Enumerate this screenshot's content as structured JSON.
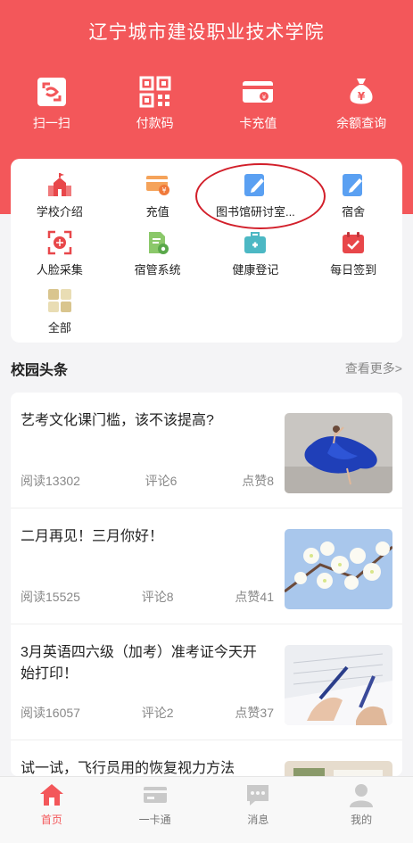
{
  "header": {
    "title": "辽宁城市建设职业技术学院",
    "quick_actions": [
      {
        "label": "扫一扫",
        "icon": "scan-icon"
      },
      {
        "label": "付款码",
        "icon": "qr-code-icon"
      },
      {
        "label": "卡充值",
        "icon": "card-recharge-icon"
      },
      {
        "label": "余额查询",
        "icon": "money-bag-icon"
      }
    ]
  },
  "services": [
    {
      "label": "学校介绍",
      "icon": "school-building-icon"
    },
    {
      "label": "充值",
      "icon": "recharge-card-icon"
    },
    {
      "label": "图书馆研讨室...",
      "icon": "edit-note-icon"
    },
    {
      "label": "宿舍",
      "icon": "edit-note-icon"
    },
    {
      "label": "人脸采集",
      "icon": "face-scan-icon"
    },
    {
      "label": "宿管系统",
      "icon": "document-gear-icon"
    },
    {
      "label": "健康登记",
      "icon": "health-kit-icon"
    },
    {
      "label": "每日签到",
      "icon": "calendar-check-icon"
    },
    {
      "label": "全部",
      "icon": "grid-all-icon"
    }
  ],
  "news_section": {
    "title": "校园头条",
    "more": "查看更多>"
  },
  "news": [
    {
      "title": "艺考文化课门槛，该不该提高?",
      "reads": "阅读13302",
      "comments": "评论6",
      "likes": "点赞8",
      "image": "dancer-photo"
    },
    {
      "title": "二月再见！三月你好！",
      "reads": "阅读15525",
      "comments": "评论8",
      "likes": "点赞41",
      "image": "blossom-photo"
    },
    {
      "title": "3月英语四六级（加考）准考证今天开始打印！",
      "reads": "阅读16057",
      "comments": "评论2",
      "likes": "点赞37",
      "image": "exam-writing-photo"
    },
    {
      "title": "试一试，飞行员用的恢复视力方法",
      "reads": "",
      "comments": "",
      "likes": "",
      "image": "eye-chart-photo"
    }
  ],
  "tabbar": [
    {
      "label": "首页",
      "icon": "home-icon",
      "active": true
    },
    {
      "label": "一卡通",
      "icon": "card-icon",
      "active": false
    },
    {
      "label": "消息",
      "icon": "message-icon",
      "active": false
    },
    {
      "label": "我的",
      "icon": "user-icon",
      "active": false
    }
  ],
  "colors": {
    "accent": "#f3575a",
    "highlight_ring": "#d21f2a"
  }
}
